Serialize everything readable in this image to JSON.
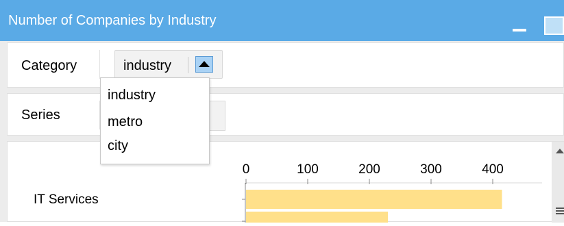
{
  "window": {
    "title": "Number of Companies by Industry"
  },
  "category": {
    "label": "Category",
    "selected": "industry"
  },
  "series": {
    "label": "Series"
  },
  "dropdown": {
    "options": [
      "industry",
      "metro",
      "city"
    ]
  },
  "chart_data": {
    "type": "bar",
    "orientation": "horizontal",
    "categories": [
      "IT Services",
      ""
    ],
    "values": [
      415,
      230
    ],
    "x_ticks": [
      "0",
      "100",
      "200",
      "300",
      "400"
    ],
    "xlim": [
      0,
      470
    ],
    "bar_color": "#ffe08a",
    "title": "",
    "xlabel": "",
    "ylabel": ""
  }
}
